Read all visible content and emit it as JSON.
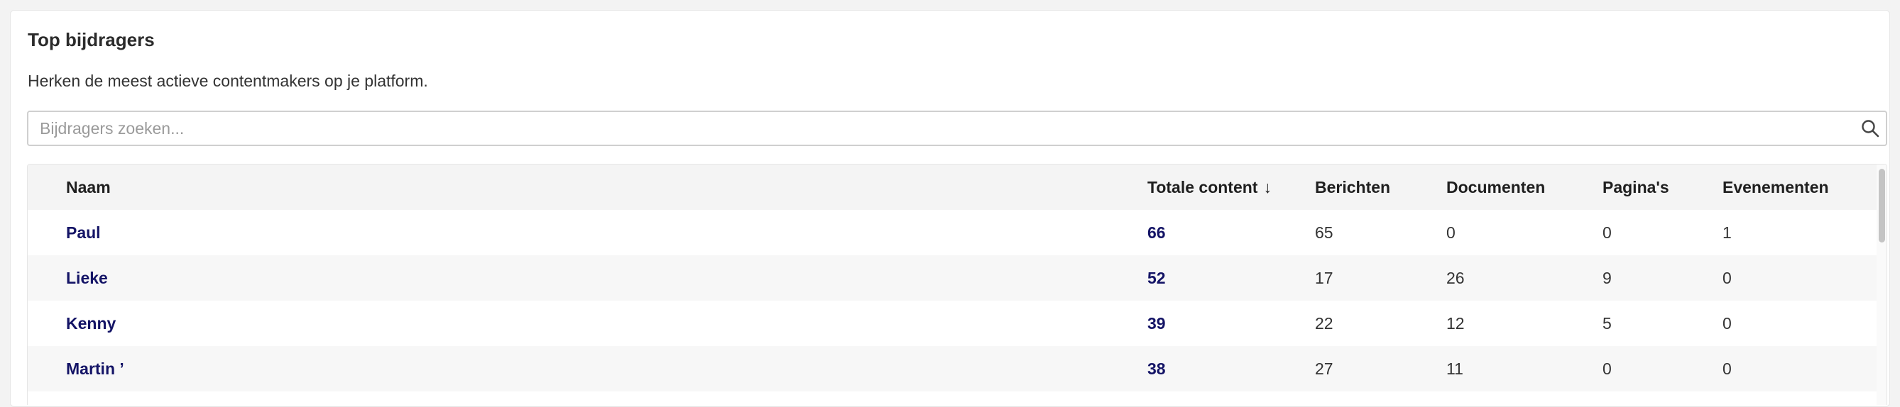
{
  "header": {
    "title": "Top bijdragers",
    "subtitle": "Herken de meest actieve contentmakers op je platform."
  },
  "search": {
    "placeholder": "Bijdragers zoeken...",
    "value": "",
    "icon": "search-icon"
  },
  "table": {
    "columns": {
      "name": "Naam",
      "total": "Totale content",
      "total_sort_indicator": "↓",
      "berichten": "Berichten",
      "documenten": "Documenten",
      "paginas": "Pagina's",
      "evenementen": "Evenementen"
    },
    "rows": [
      {
        "name": "Paul",
        "total": "66",
        "berichten": "65",
        "documenten": "0",
        "paginas": "0",
        "evenementen": "1"
      },
      {
        "name": "Lieke",
        "total": "52",
        "berichten": "17",
        "documenten": "26",
        "paginas": "9",
        "evenementen": "0"
      },
      {
        "name": "Kenny",
        "total": "39",
        "berichten": "22",
        "documenten": "12",
        "paginas": "5",
        "evenementen": "0"
      },
      {
        "name": "Martin ’",
        "total": "38",
        "berichten": "27",
        "documenten": "11",
        "paginas": "0",
        "evenementen": "0"
      }
    ]
  },
  "colors": {
    "link": "#141466",
    "header_bg": "#f4f4f4",
    "row_alt_bg": "#f7f7f7"
  }
}
